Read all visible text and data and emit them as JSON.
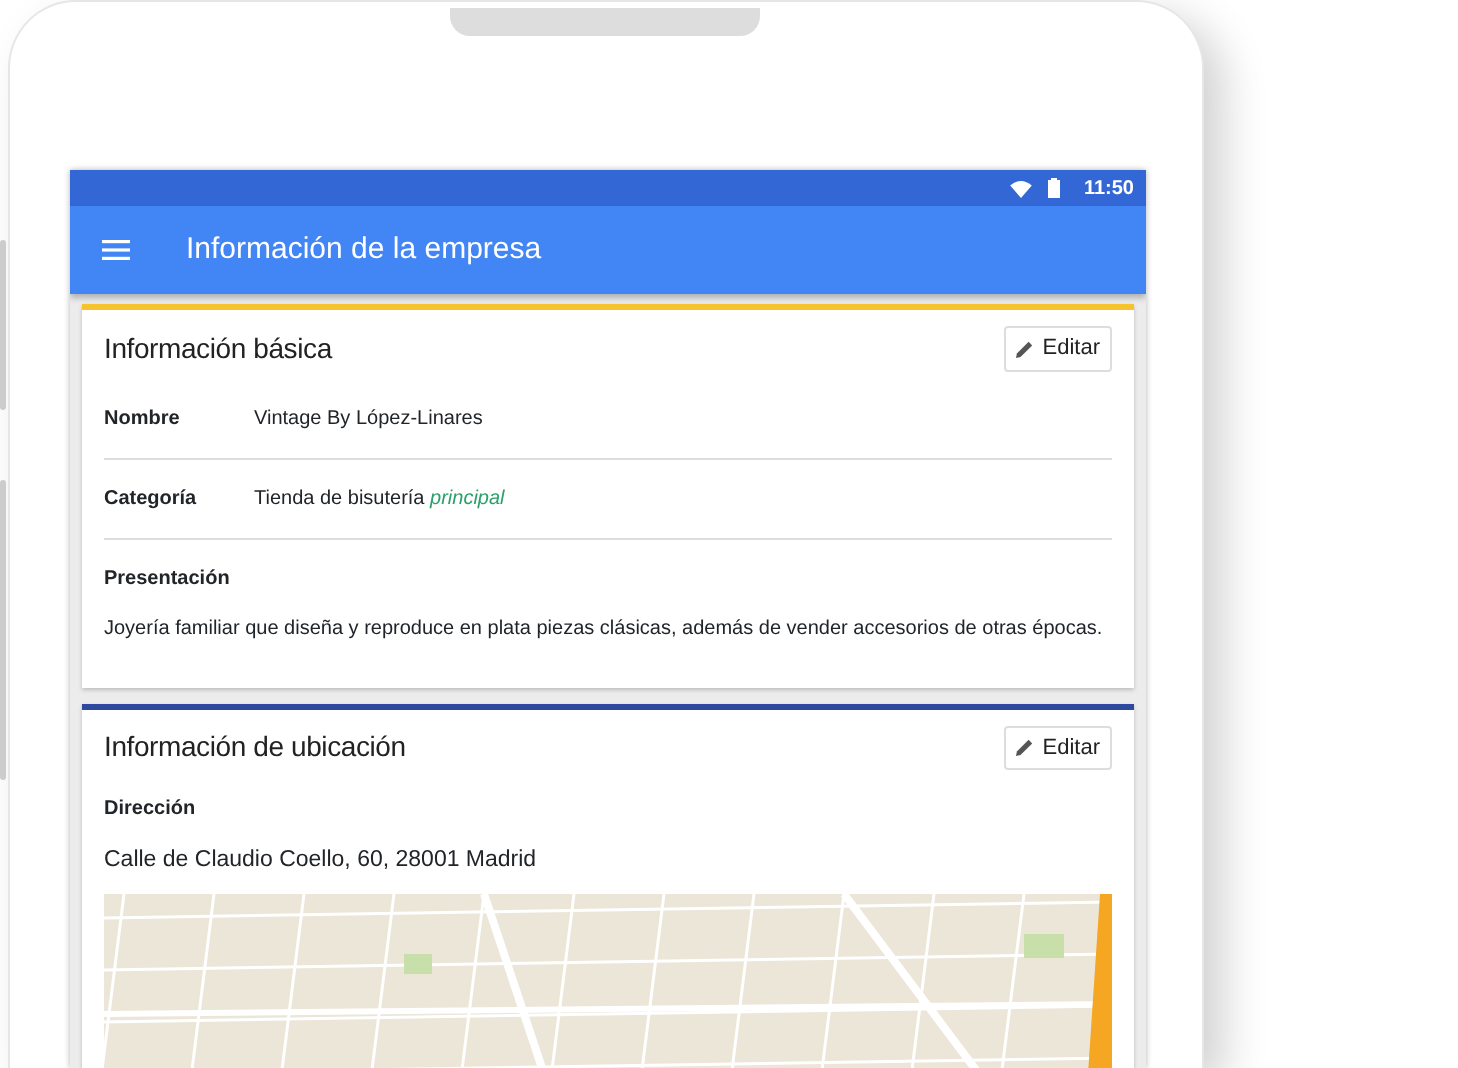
{
  "status_bar": {
    "time": "11:50"
  },
  "app_bar": {
    "title": "Información de la empresa"
  },
  "cards": [
    {
      "title": "Información básica",
      "color": "#f6c32c",
      "edit_button": "Editar",
      "fields": [
        {
          "kind": "row",
          "label": "Nombre",
          "value": "Vintage By López-Linares"
        },
        {
          "kind": "row",
          "label": "Categoría",
          "value": "Tienda de bisutería *principal*"
        },
        {
          "kind": "stacked",
          "label": "Presentación",
          "value": "Joyería familiar que diseña y reproduce en plata piezas clásicas, además de vender accesorios de otras épocas."
        }
      ]
    },
    {
      "title": "Información de ubicación",
      "color": "#3049a0",
      "edit_button": "Editar",
      "fields": [
        {
          "kind": "address",
          "label": "Dirección",
          "value": "Calle de Claudio Coello, 60, 28001 Madrid"
        },
        {
          "kind": "map"
        }
      ]
    }
  ]
}
